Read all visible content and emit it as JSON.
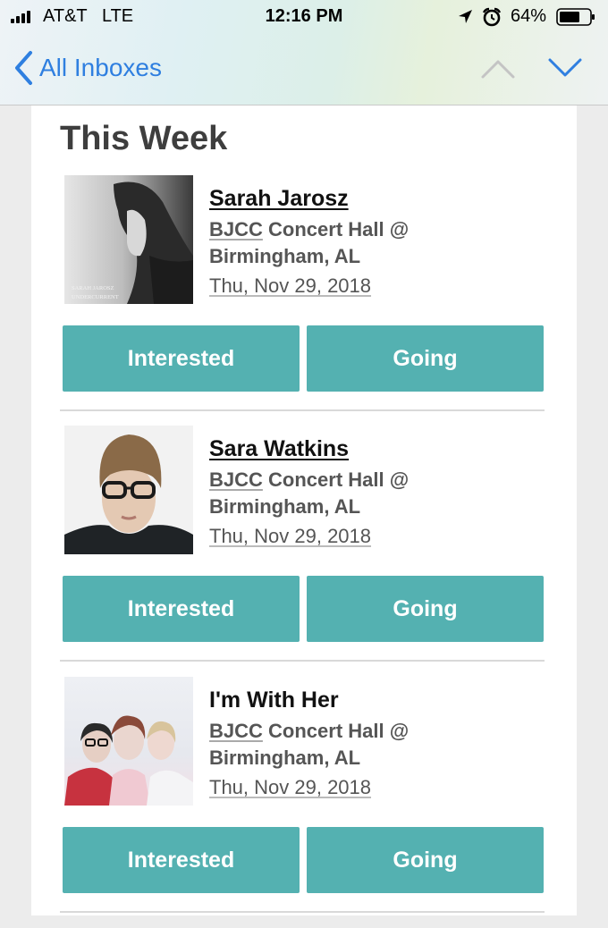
{
  "status_bar": {
    "carrier": "AT&T   LTE",
    "time": "12:16 PM",
    "battery": "64%"
  },
  "nav": {
    "back_label": "All Inboxes"
  },
  "section": {
    "title": "This Week"
  },
  "events": [
    {
      "artist": "Sarah Jarosz",
      "venue_abbr": "BJCC",
      "venue_rest": " Concert Hall @",
      "city": "Birmingham, AL",
      "date": "Thu, Nov 29, 2018",
      "cover_text_1": "SARAH JAROSZ",
      "cover_text_2": "UNDERCURRENT",
      "interested_label": "Interested",
      "going_label": "Going"
    },
    {
      "artist": "Sara Watkins",
      "venue_abbr": "BJCC",
      "venue_rest": " Concert Hall @",
      "city": "Birmingham, AL",
      "date": "Thu, Nov 29, 2018",
      "interested_label": "Interested",
      "going_label": "Going"
    },
    {
      "artist": "I'm With Her",
      "venue_abbr": "BJCC",
      "venue_rest": " Concert Hall @",
      "city": "Birmingham, AL",
      "date": "Thu, Nov 29, 2018",
      "interested_label": "Interested",
      "going_label": "Going"
    }
  ],
  "colors": {
    "accent_blue": "#2f7fe0",
    "button_teal": "#54b1b1"
  }
}
